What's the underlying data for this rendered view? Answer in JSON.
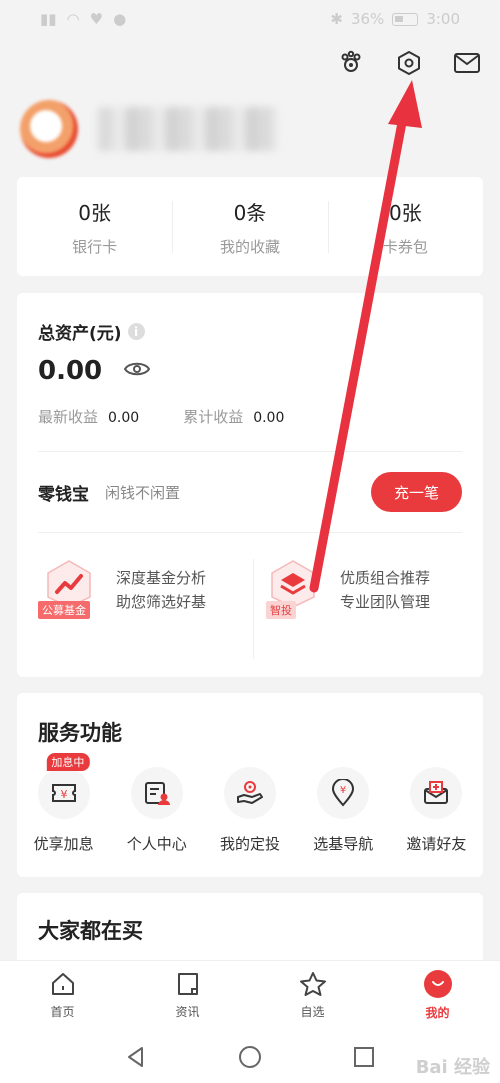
{
  "status_bar": {
    "battery": "36%",
    "time": "3:00"
  },
  "header_icons": [
    "paw-icon",
    "settings-icon",
    "mail-icon"
  ],
  "stats": [
    {
      "value": "0张",
      "label": "银行卡"
    },
    {
      "value": "0条",
      "label": "我的收藏"
    },
    {
      "value": "0张",
      "label": "卡券包"
    }
  ],
  "assets": {
    "title": "总资产(元)",
    "value": "0.00",
    "latest_label": "最新收益",
    "latest_value": "0.00",
    "total_label": "累计收益",
    "total_value": "0.00"
  },
  "lingqian": {
    "title": "零钱宝",
    "subtitle": "闲钱不闲置",
    "button": "充一笔"
  },
  "promos": [
    {
      "badge": "公募基金",
      "line1": "深度基金分析",
      "line2": "助您筛选好基"
    },
    {
      "badge": "智投",
      "line1": "优质组合推荐",
      "line2": "专业团队管理"
    }
  ],
  "services": {
    "title": "服务功能",
    "items": [
      {
        "label": "优享加息",
        "tag": "加息中",
        "icon": "coupon-yen-icon"
      },
      {
        "label": "个人中心",
        "icon": "id-card-icon"
      },
      {
        "label": "我的定投",
        "icon": "hand-coin-icon"
      },
      {
        "label": "选基导航",
        "icon": "location-yen-icon"
      },
      {
        "label": "邀请好友",
        "icon": "invite-envelope-icon"
      }
    ]
  },
  "hot": {
    "title": "大家都在买"
  },
  "bottom_nav": [
    {
      "label": "首页",
      "icon": "home-icon"
    },
    {
      "label": "资讯",
      "icon": "news-icon"
    },
    {
      "label": "自选",
      "icon": "star-icon"
    },
    {
      "label": "我的",
      "icon": "me-icon",
      "active": true
    }
  ],
  "watermark": "Bai 经验",
  "colors": {
    "accent": "#e93b3d",
    "background": "#f3f3f3"
  }
}
